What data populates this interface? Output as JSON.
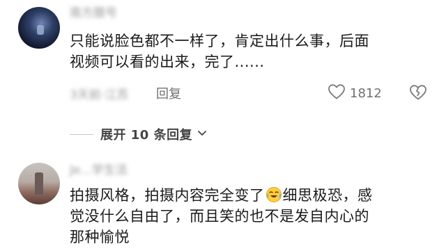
{
  "comments": [
    {
      "username": "南方腊号",
      "text_lines": [
        "只能说脸色都不一样了，肯定出什么事，后面",
        "视频可以看的出来，完了......"
      ],
      "time": "3天前·江苏",
      "reply_label": "回复",
      "like_count": "1812"
    },
    {
      "username": "Je...学生活",
      "text_line1_before_emoji": "拍摄风格，拍摄内容完全变了",
      "emoji": "crying-laughing-emoji",
      "text_line1_after_emoji": "细思极恐，感",
      "text_line2": "觉没什么自由了，而且笑的也不是发自内心的",
      "text_line3": "那种愉悦"
    }
  ],
  "expand_replies": {
    "label": "展开 10 条回复"
  },
  "colors": {
    "text": "#1a1a1a",
    "muted": "#9a9a9a",
    "action": "#707070"
  }
}
